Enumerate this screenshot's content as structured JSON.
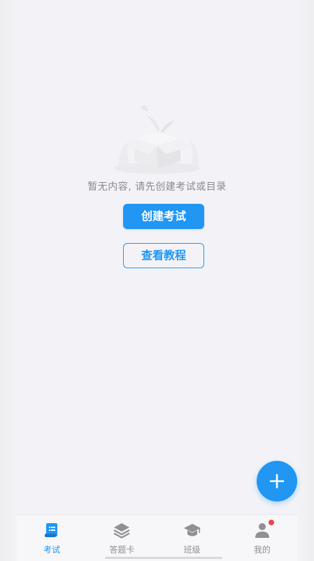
{
  "empty_state": {
    "message": "暂无内容, 请先创建考试或目录",
    "illustration": "empty-box-illustration"
  },
  "actions": {
    "create_exam_label": "创建考试",
    "view_tutorial_label": "查看教程"
  },
  "fab": {
    "icon": "plus-icon"
  },
  "tabbar": {
    "items": [
      {
        "label": "考试",
        "icon": "exam-scroll-icon",
        "active": true
      },
      {
        "label": "答题卡",
        "icon": "layers-icon",
        "active": false
      },
      {
        "label": "班级",
        "icon": "graduation-cap-icon",
        "active": false
      },
      {
        "label": "我的",
        "icon": "user-icon",
        "active": false,
        "badge": true
      }
    ]
  },
  "colors": {
    "accent": "#2196f3",
    "inactive": "#8f8f94",
    "badge": "#f04545",
    "background": "#f3f3f7"
  }
}
